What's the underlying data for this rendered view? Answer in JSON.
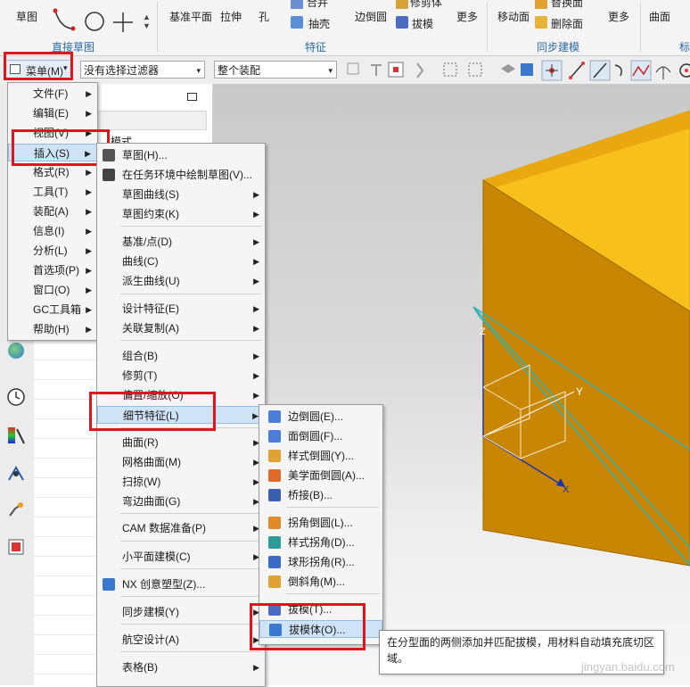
{
  "ribbon": {
    "sketch_label": "草图",
    "group_direct_sketch": "直接草图",
    "datum_plane_label": "基准平面",
    "extrude_label": "拉伸",
    "hole_label": "孔",
    "unite_label": "合并",
    "shell_label": "抽壳",
    "edge_blend_label": "边倒圆",
    "trim_body_label": "修剪体",
    "draft_label": "拔模",
    "more_label_1": "更多",
    "group_feature": "特征",
    "move_face_label": "移动面",
    "replace_face_label": "替换面",
    "delete_face_label": "删除面",
    "more_label_2": "更多",
    "group_sync_modeling": "同步建模",
    "surface_label": "曲面",
    "group_partial": "标"
  },
  "toolbar": {
    "menu_button_label": "菜单(M)",
    "filter_value": "没有选择过滤器",
    "assembly_value": "整个装配"
  },
  "navigator": {
    "fragment_text": "模式"
  },
  "main_menu": [
    {
      "label": "文件(F)",
      "arrow": true
    },
    {
      "label": "编辑(E)",
      "arrow": true
    },
    {
      "label": "视图(V)",
      "arrow": true
    },
    {
      "label": "插入(S)",
      "arrow": true
    },
    {
      "label": "格式(R)",
      "arrow": true
    },
    {
      "label": "工具(T)",
      "arrow": true
    },
    {
      "label": "装配(A)",
      "arrow": true
    },
    {
      "label": "信息(I)",
      "arrow": true
    },
    {
      "label": "分析(L)",
      "arrow": true
    },
    {
      "label": "首选项(P)",
      "arrow": true
    },
    {
      "label": "窗口(O)",
      "arrow": true
    },
    {
      "label": "GC工具箱",
      "arrow": true
    },
    {
      "label": "帮助(H)",
      "arrow": true
    }
  ],
  "insert_menu": [
    {
      "label": "草图(H)...",
      "arrow": false,
      "icon": "sketch-icon"
    },
    {
      "label": "在任务环境中绘制草图(V)...",
      "arrow": false,
      "icon": "sketch-task-icon"
    },
    {
      "label": "草图曲线(S)",
      "arrow": true
    },
    {
      "label": "草图约束(K)",
      "arrow": true
    },
    {
      "label": "基准/点(D)",
      "arrow": true
    },
    {
      "label": "曲线(C)",
      "arrow": true
    },
    {
      "label": "派生曲线(U)",
      "arrow": true
    },
    {
      "label": "设计特征(E)",
      "arrow": true
    },
    {
      "label": "关联复制(A)",
      "arrow": true
    },
    {
      "label": "组合(B)",
      "arrow": true
    },
    {
      "label": "修剪(T)",
      "arrow": true
    },
    {
      "label": "偏置/缩放(O)",
      "arrow": true
    },
    {
      "label": "细节特征(L)",
      "arrow": true
    },
    {
      "label": "曲面(R)",
      "arrow": true
    },
    {
      "label": "网格曲面(M)",
      "arrow": true
    },
    {
      "label": "扫掠(W)",
      "arrow": true
    },
    {
      "label": "弯边曲面(G)",
      "arrow": true
    },
    {
      "label": "CAM 数据准备(P)",
      "arrow": true
    },
    {
      "label": "小平面建模(C)",
      "arrow": true
    },
    {
      "label": "NX 创意塑型(Z)...",
      "arrow": false,
      "icon": "nx-realize-shape-icon"
    },
    {
      "label": "同步建模(Y)",
      "arrow": true
    },
    {
      "label": "航空设计(A)",
      "arrow": true
    },
    {
      "label": "表格(B)",
      "arrow": true
    }
  ],
  "detail_menu": [
    {
      "label": "边倒圆(E)...",
      "icon": "edge-blend-icon"
    },
    {
      "label": "面倒圆(F)...",
      "icon": "face-blend-icon"
    },
    {
      "label": "样式倒圆(Y)...",
      "icon": "styled-blend-icon"
    },
    {
      "label": "美学面倒圆(A)...",
      "icon": "aesthetic-blend-icon"
    },
    {
      "label": "桥接(B)...",
      "icon": "bridge-icon"
    },
    {
      "label": "拐角倒圆(L)...",
      "icon": "corner-blend-icon"
    },
    {
      "label": "样式拐角(D)...",
      "icon": "styled-corner-icon"
    },
    {
      "label": "球形拐角(R)...",
      "icon": "spherical-corner-icon"
    },
    {
      "label": "倒斜角(M)...",
      "icon": "chamfer-icon"
    },
    {
      "label": "拔模(T)...",
      "icon": "draft-icon"
    },
    {
      "label": "拔模体(O)...",
      "icon": "draft-body-icon"
    }
  ],
  "tooltip": {
    "text": "在分型面的两侧添加并匹配拔模，用材料自动填充底切区域。"
  },
  "viewport": {
    "axis_x": "X",
    "axis_y": "Y",
    "axis_z": "Z"
  },
  "watermark": "jingyan.baidu.com",
  "colors": {
    "block_top": "#f7c01a",
    "block_front": "#c98603",
    "block_side": "#a96b00",
    "datum_plane": "#2fb3b5",
    "highlight_box": "#e0141b",
    "menu_hover": "#cfe3f6",
    "group_title": "#2a6aa8"
  }
}
